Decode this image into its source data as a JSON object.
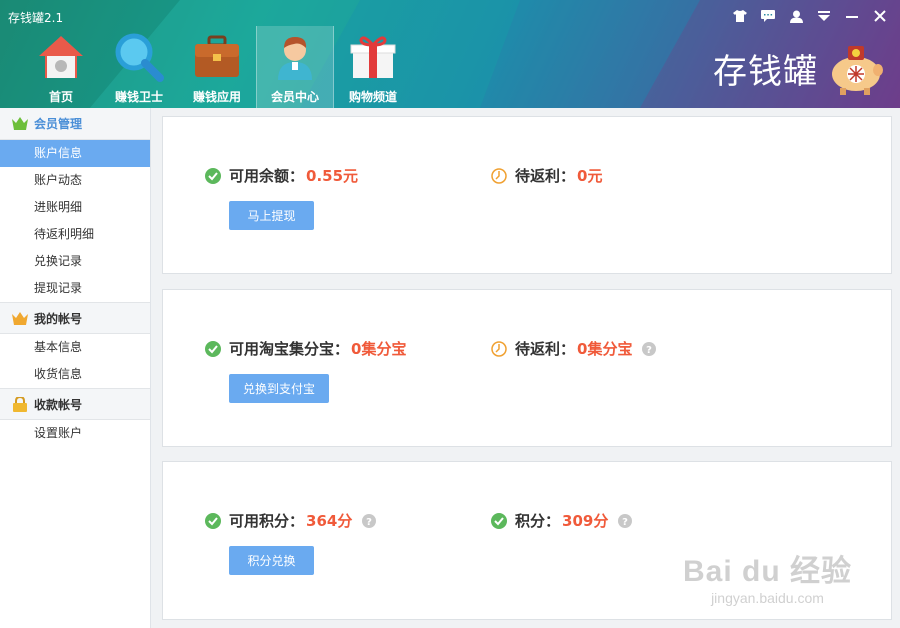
{
  "app": {
    "title": "存钱罐2.1",
    "brand": "存钱罐"
  },
  "nav": [
    {
      "label": "首页",
      "icon": "home-icon"
    },
    {
      "label": "赚钱卫士",
      "icon": "magnifier-icon"
    },
    {
      "label": "赚钱应用",
      "icon": "briefcase-icon"
    },
    {
      "label": "会员中心",
      "icon": "member-avatar-icon",
      "active": true
    },
    {
      "label": "购物频道",
      "icon": "gift-icon"
    }
  ],
  "sidebar": {
    "groups": [
      {
        "title": "会员管理",
        "icon": "crown-green-icon",
        "items": [
          "账户信息",
          "账户动态",
          "进账明细",
          "待返利明细",
          "兑换记录",
          "提现记录"
        ]
      },
      {
        "title": "我的帐号",
        "icon": "crown-orange-icon",
        "items": [
          "基本信息",
          "收货信息"
        ]
      },
      {
        "title": "收款帐号",
        "icon": "lock-icon",
        "items": [
          "设置账户"
        ]
      }
    ],
    "active_item": "账户信息"
  },
  "cards": [
    {
      "left_label": "可用余额：",
      "left_value": "0.55元",
      "right_label": "待返利：",
      "right_value": "0元",
      "button": "马上提现"
    },
    {
      "left_label": "可用淘宝集分宝：",
      "left_value": "0集分宝",
      "right_label": "待返利：",
      "right_value": "0集分宝",
      "button": "兑换到支付宝"
    },
    {
      "left_label": "可用积分：",
      "left_value": "364分",
      "right_label": "积分：",
      "right_value": "309分",
      "button": "积分兑换"
    }
  ],
  "watermark": {
    "line1": "Bai du 经验",
    "line2": "jingyan.baidu.com"
  },
  "colors": {
    "accent": "#6aaaf0",
    "value": "#f05a3a",
    "check": "#5cb85c",
    "clock": "#f0a030"
  }
}
